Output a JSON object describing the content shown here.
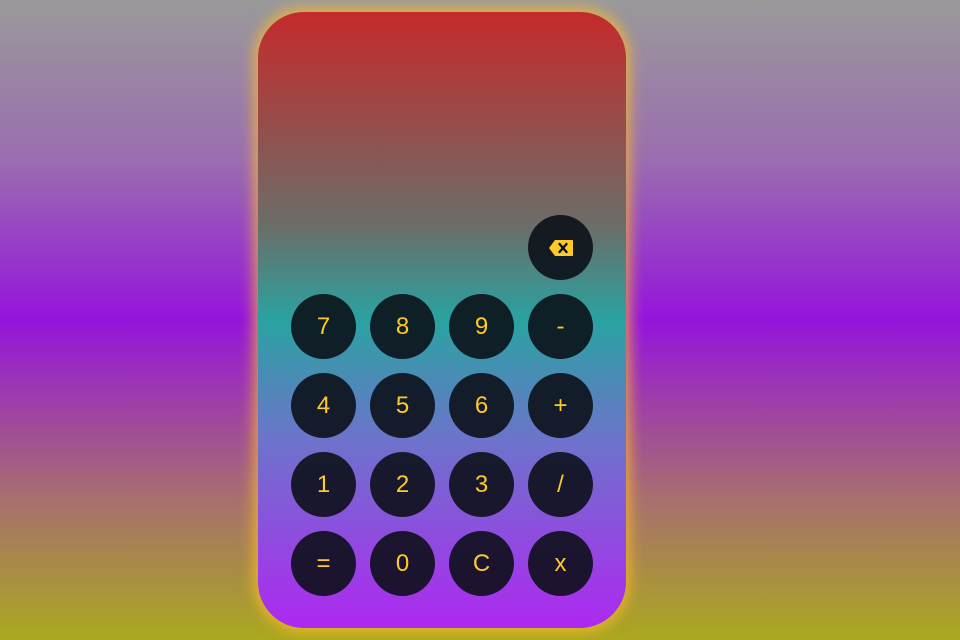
{
  "display": {
    "value": ""
  },
  "keys": {
    "backspace": {
      "icon": "backspace-icon"
    },
    "row1": [
      "7",
      "8",
      "9",
      "-"
    ],
    "row2": [
      "4",
      "5",
      "6",
      "+"
    ],
    "row3": [
      "1",
      "2",
      "3",
      "/"
    ],
    "row4": [
      "=",
      "0",
      "C",
      "x"
    ]
  },
  "colors": {
    "key_text": "#ffc928",
    "key_background": "#0a0e16",
    "glow": "#ffbe28"
  }
}
